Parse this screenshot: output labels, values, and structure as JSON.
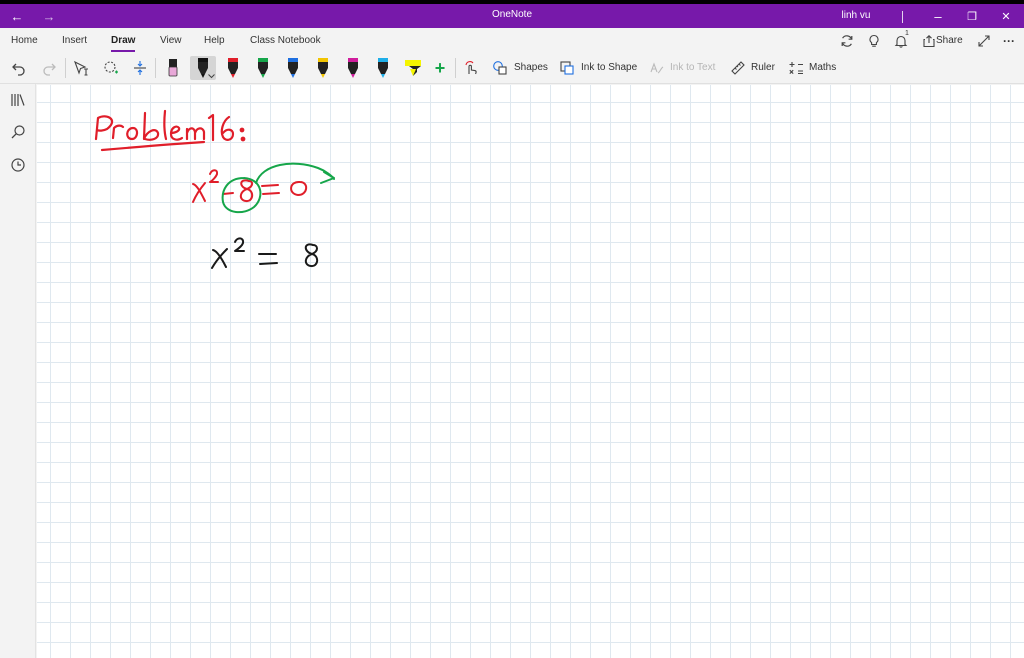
{
  "titlebar": {
    "app_title": "OneNote",
    "user_name": "linh vu",
    "back_icon": "←",
    "forward_icon": "→",
    "minimize_icon": "–",
    "maximize_icon": "❐",
    "close_icon": "✕"
  },
  "tabs": [
    {
      "label": "Home"
    },
    {
      "label": "Insert"
    },
    {
      "label": "Draw",
      "active": true
    },
    {
      "label": "View"
    },
    {
      "label": "Help"
    },
    {
      "label": "Class Notebook"
    }
  ],
  "ribbon_right": {
    "share_label": "Share",
    "notification_count": "1",
    "more_icon": "···"
  },
  "toolbar": {
    "shapes_label": "Shapes",
    "ink_to_shape_label": "Ink to Shape",
    "ink_to_text_label": "Ink to Text",
    "ruler_label": "Ruler",
    "maths_label": "Maths",
    "add_pen_icon": "+"
  },
  "pens": [
    {
      "name": "eraser",
      "color": "#e8a8d8"
    },
    {
      "name": "black-pen-selected",
      "color": "#111111"
    },
    {
      "name": "red-pen",
      "color": "#e01e2a"
    },
    {
      "name": "green-pen",
      "color": "#16a64a"
    },
    {
      "name": "blue-pen",
      "color": "#1e6fe0"
    },
    {
      "name": "yellow-pen",
      "color": "#f2c400"
    },
    {
      "name": "magenta-pen",
      "color": "#d01d9c"
    },
    {
      "name": "cyan-pen",
      "color": "#1eaee8"
    },
    {
      "name": "highlighter-yellow",
      "color": "#f5f500"
    }
  ],
  "colors": {
    "brand": "#7719aa",
    "ink_red": "#e01e2a",
    "ink_green": "#16a64a",
    "ink_black": "#1a1a1a",
    "grid_line": "#dfe8ef"
  },
  "note": {
    "heading": "Problem 16 :",
    "equation_1": "x² − 8 = 0",
    "equation_2": "x² = 8"
  }
}
